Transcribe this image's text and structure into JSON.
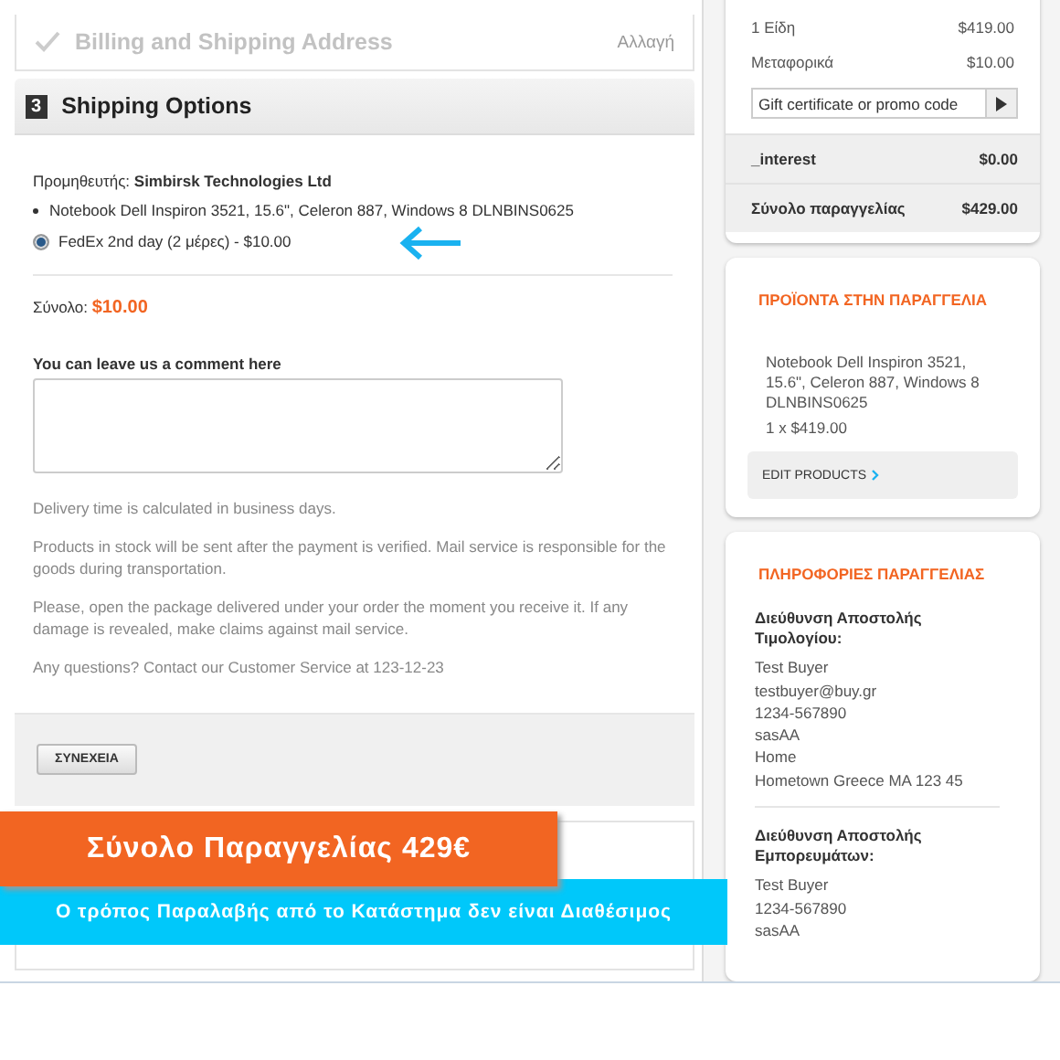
{
  "billing_step": {
    "title": "Billing and Shipping Address",
    "done": true,
    "action": "Αλλαγή"
  },
  "shipping_step": {
    "number": "3",
    "title": "Shipping Options"
  },
  "supplier": {
    "label": "Προμηθευτής:",
    "name": "Simbirsk Technologies Ltd"
  },
  "products": [
    "Notebook Dell Inspiron 3521, 15.6\", Celeron 887, Windows 8 DLNBINS0625"
  ],
  "shipping_methods": [
    {
      "label": "FedEx 2nd day (2 μέρες) - $10.00",
      "selected": true
    }
  ],
  "subtotal": {
    "label": "Σύνολο:",
    "value": "$10.00"
  },
  "comment": {
    "label": "You can leave us a comment here"
  },
  "notes": [
    "Delivery time is calculated in business days.",
    "Products in stock will be sent after the payment is verified. Mail service is responsible for the goods during transportation.",
    "Please, open the package delivered under your order the moment you receive it. If any damage is revealed, make claims against mail service.",
    "Any questions? Contact our Customer Service at 123-12-23"
  ],
  "continue_button": "ΣΥΝΕΧΕΙΑ",
  "summary": {
    "lines": [
      {
        "label": "1 Είδη",
        "value": "$419.00"
      },
      {
        "label": "Μεταφορικά",
        "value": "$10.00"
      }
    ],
    "promo_placeholder": "Gift certificate or promo code",
    "totals": [
      {
        "label": "_interest",
        "value": "$0.00"
      },
      {
        "label": "Σύνολο παραγγελίας",
        "value": "$429.00"
      }
    ]
  },
  "order_products": {
    "title": "ΠΡΟΪΟΝΤΑ ΣΤΗΝ ΠΑΡΑΓΓΕΛΙΑ",
    "items": [
      {
        "name": "Notebook Dell Inspiron 3521, 15.6\", Celeron 887, Windows 8 DLNBINS0625",
        "qty": "1 x $419.00"
      }
    ],
    "edit": "EDIT PRODUCTS"
  },
  "order_info": {
    "title": "ΠΛΗΡΟΦΟΡΙΕΣ ΠΑΡΑΓΓΕΛΙΑΣ",
    "addresses": [
      {
        "title": "Διεύθυνση Αποστολής Τιμολογίου:",
        "lines": [
          "Test Buyer",
          "testbuyer@buy.gr",
          "1234-567890",
          "sasAA",
          "Home",
          "Hometown Greece MA 123 45"
        ]
      },
      {
        "title": "Διεύθυνση Αποστολής Εμπορευμάτων:",
        "lines": [
          "Test Buyer",
          "1234-567890",
          "sasAA"
        ]
      }
    ]
  },
  "banners": {
    "total": "Σύνολο Παραγγελίας 429€",
    "pickup": "Ο τρόπος Παραλαβής από το Κατάστημα δεν είναι Διαθέσιμος"
  }
}
